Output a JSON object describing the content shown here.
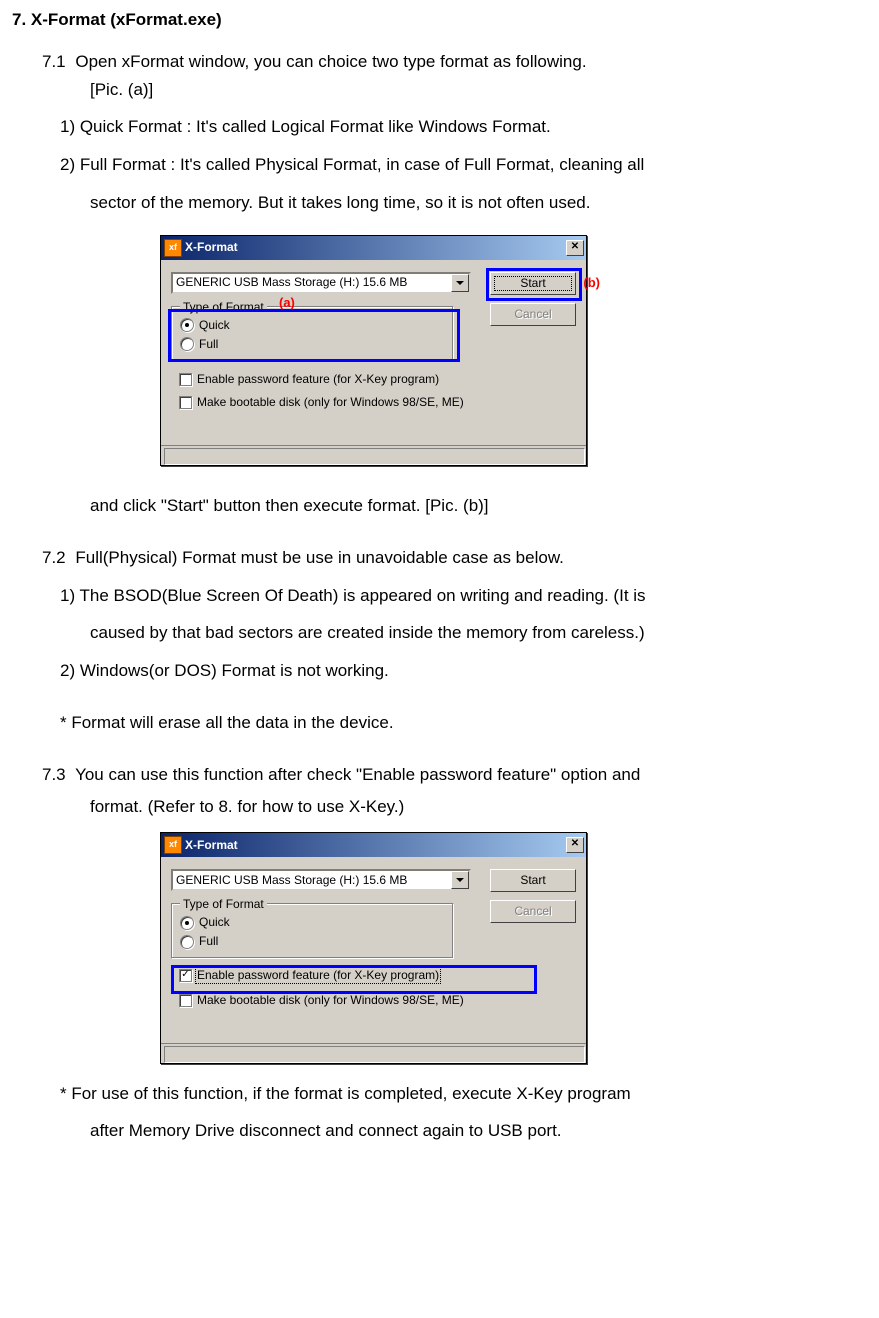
{
  "heading": "7. X-Format (xFormat.exe)",
  "s71": {
    "num": "7.1",
    "line1": "Open xFormat window, you can choice two type format as following.",
    "line2": "[Pic. (a)]",
    "item1": "1) Quick Format : It's called Logical Format like Windows Format.",
    "item2a": "2) Full Format : It's called Physical Format, in case of Full Format, cleaning all",
    "item2b": "sector of the memory. But it takes long time, so it is not often used.",
    "after": "and click \"Start\" button then execute format. [Pic. (b)]"
  },
  "s72": {
    "num": "7.2",
    "line1": "Full(Physical) Format must be use in unavoidable case as below.",
    "item1a": "1) The BSOD(Blue Screen Of Death) is appeared on writing and reading. (It is",
    "item1b": "caused by that bad sectors are created inside the memory from careless.)",
    "item2": "2) Windows(or DOS) Format is not working.",
    "note": "* Format will erase all the data in the device."
  },
  "s73": {
    "num": "7.3",
    "line1": "You can use this function after check \"Enable password feature\" option and",
    "line2": "format. (Refer to 8. for how to use X-Key.)",
    "note1": "* For use of this function, if the format is completed, execute X-Key program",
    "note2": "after Memory Drive disconnect and connect again to USB port."
  },
  "dialog": {
    "title": "X-Format",
    "icon": "xf",
    "dropdown": "GENERIC USB Mass Storage (H:)  15.6 MB",
    "start": "Start",
    "cancel": "Cancel",
    "fieldset_label": "Type of Format",
    "quick": "Quick",
    "full": "Full",
    "check1": "Enable password feature (for X-Key program)",
    "check2": "Make bootable disk (only for Windows 98/SE, ME)"
  },
  "annot": {
    "a": "(a)",
    "b": "(b)",
    "check": "✓"
  }
}
